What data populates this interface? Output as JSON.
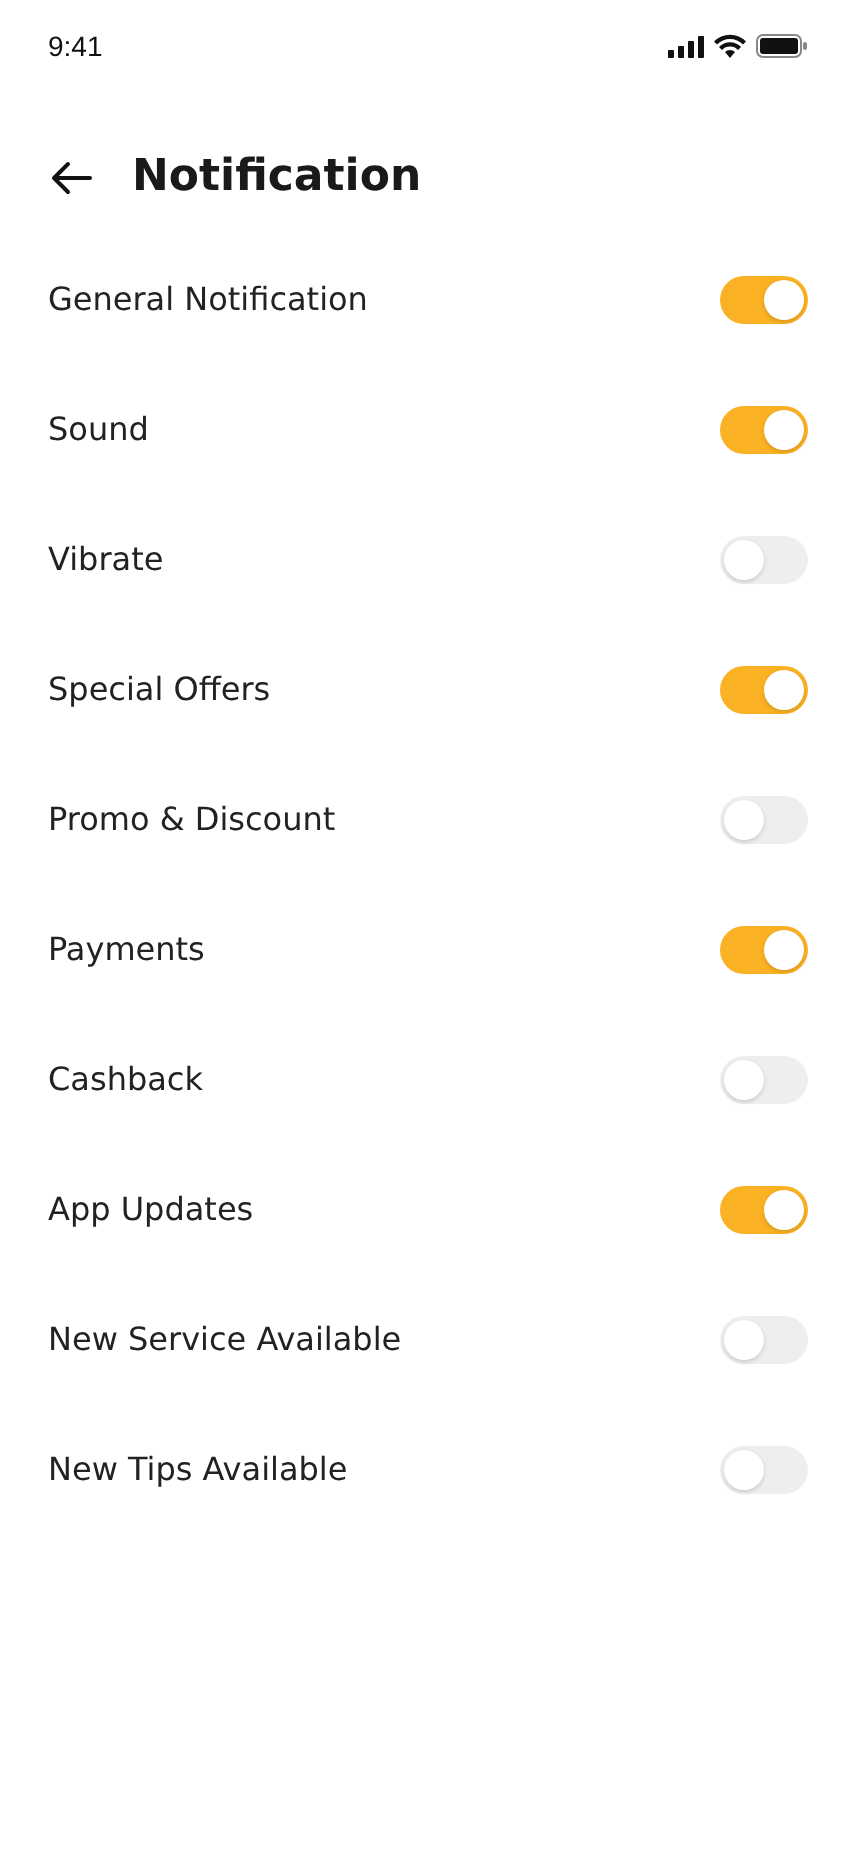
{
  "status_bar": {
    "time": "9:41"
  },
  "header": {
    "title": "Notification"
  },
  "settings": [
    {
      "label": "General Notification",
      "on": true
    },
    {
      "label": "Sound",
      "on": true
    },
    {
      "label": "Vibrate",
      "on": false
    },
    {
      "label": "Special Offers",
      "on": true
    },
    {
      "label": "Promo & Discount",
      "on": false
    },
    {
      "label": "Payments",
      "on": true
    },
    {
      "label": "Cashback",
      "on": false
    },
    {
      "label": "App Updates",
      "on": true
    },
    {
      "label": "New Service Available",
      "on": false
    },
    {
      "label": "New Tips Available",
      "on": false
    }
  ]
}
